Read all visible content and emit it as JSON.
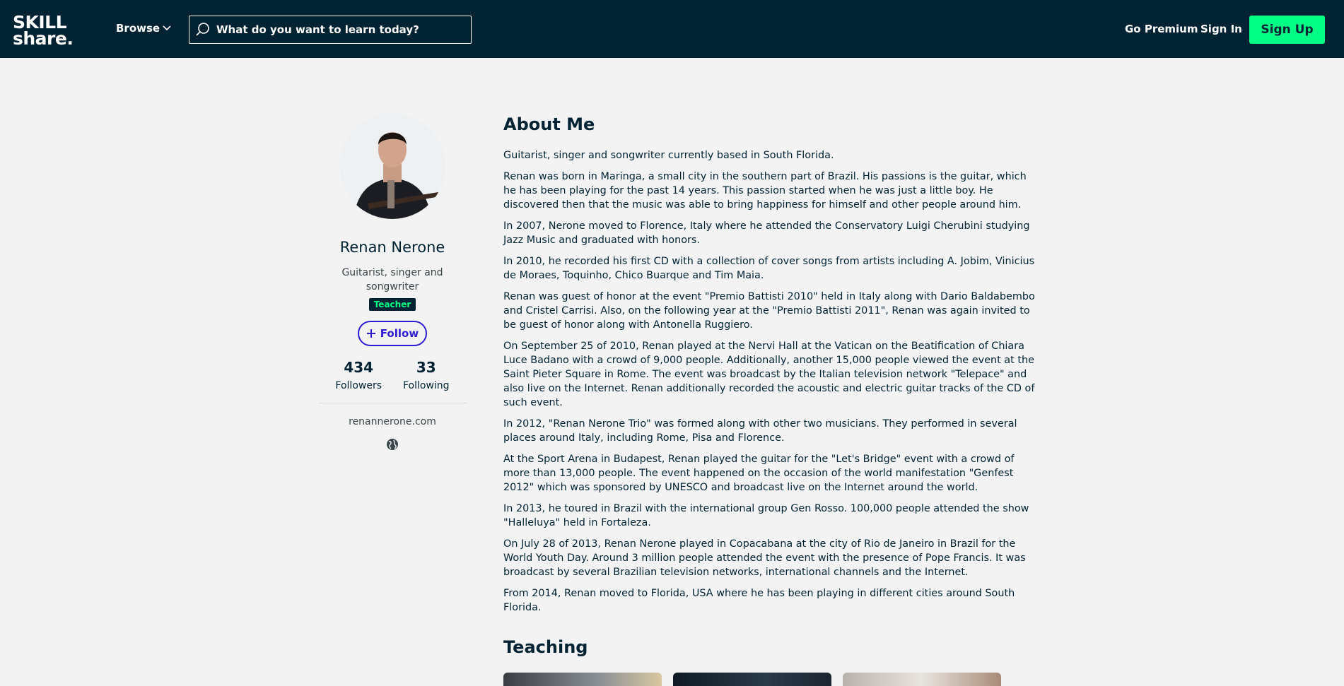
{
  "header": {
    "logo_line1": "SKILL",
    "logo_line2": "share.",
    "browse_label": "Browse",
    "search_placeholder": "What do you want to learn today?",
    "go_premium": "Go Premium",
    "sign_in": "Sign In",
    "sign_up": "Sign Up"
  },
  "profile": {
    "name": "Renan Nerone",
    "headline": "Guitarist, singer and songwriter",
    "badge": "Teacher",
    "follow_label": "Follow",
    "followers_count": "434",
    "followers_label": "Followers",
    "following_count": "33",
    "following_label": "Following",
    "website": "renannerone.com"
  },
  "about": {
    "title": "About Me",
    "paragraphs": [
      "Guitarist, singer and songwriter currently based in South Florida.",
      "Renan was born in Maringa, a small city in the southern part of Brazil. His passions is the guitar, which he has been playing for the past 14 years. This passion started when he was just a little boy. He discovered then that the music was able to bring happiness for himself and other people around him.",
      "In 2007, Nerone moved to Florence, Italy where he attended the Conservatory Luigi Cherubini studying Jazz Music and graduated with honors.",
      "In 2010, he recorded his first CD with a collection of cover songs from artists including A. Jobim, Vinicius de Moraes, Toquinho, Chico Buarque and Tim Maia.",
      "Renan was guest of honor at the event \"Premio Battisti 2010\" held in Italy along with Dario Baldabembo and Cristel Carrisi. Also, on the following year at the \"Premio Battisti 2011\", Renan was again invited to be guest of honor along with Antonella Ruggiero.",
      "On September 25 of 2010, Renan played at the Nervi Hall at the Vatican on the Beatification of Chiara Luce Badano with a crowd of 9,000 people. Additionally, another 15,000 people viewed the event at the Saint Pieter Square in Rome. The event was broadcast by the Italian television network \"Telepace\" and also live on the Internet. Renan additionally recorded the acoustic and electric guitar tracks of the CD of such event.",
      "In 2012,  \"Renan Nerone Trio\" was formed along with other two musicians. They performed in several places around Italy, including Rome, Pisa and Florence.",
      "At the Sport Arena in Budapest, Renan played the guitar for the \"Let's Bridge\" event with a crowd of more than 13,000 people. The event happened on the occasion of the world manifestation \"Genfest 2012\" which was sponsored by UNESCO and broadcast live on the Internet around the world.",
      "In 2013, he toured in Brazil with the international group Gen Rosso. 100,000 people attended the show \"Halleluya\" held in Fortaleza.",
      "On July 28 of 2013, Renan Nerone played in Copacabana at the city of Rio de Janeiro in Brazil for the World Youth Day. Around 3 million people attended the event with the presence of Pope Francis. It was broadcast by several Brazilian television networks, international channels and the Internet.",
      "From 2014, Renan moved to Florida, USA where he has been playing in different cities around South Florida."
    ]
  },
  "teaching": {
    "title": "Teaching"
  },
  "colors": {
    "header_bg": "#002333",
    "accent_green": "#00ff84",
    "follow_blue": "#2f1bd5",
    "page_bg": "#f3f3f3"
  },
  "icons": [
    "search-icon",
    "chevron-down-icon",
    "plus-icon",
    "globe-icon"
  ]
}
